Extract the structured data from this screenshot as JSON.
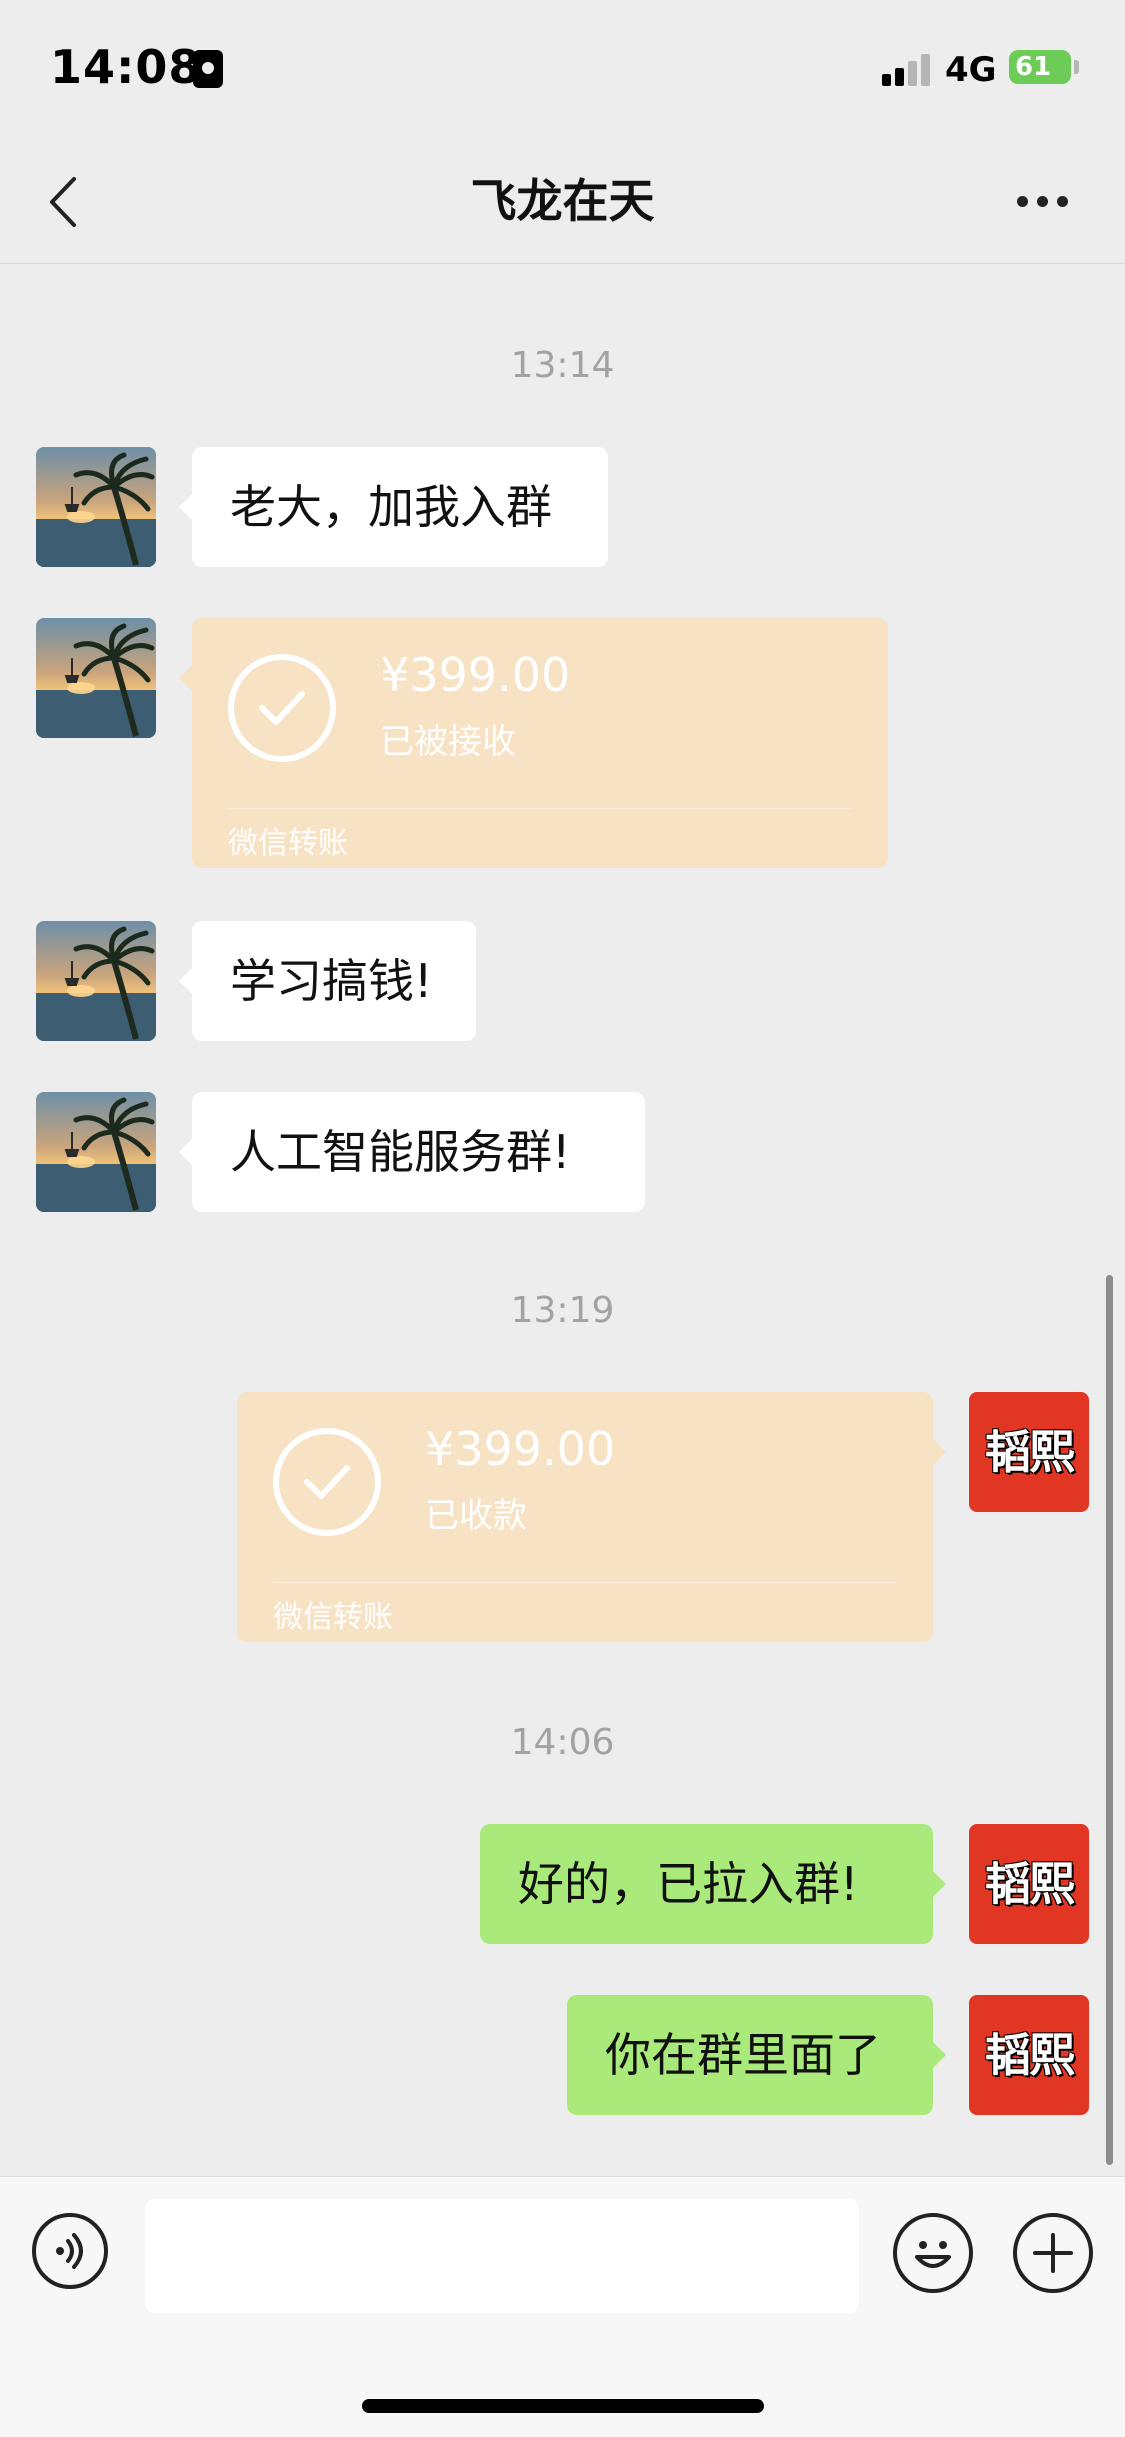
{
  "status_bar": {
    "time": "14:08",
    "network": "4G",
    "battery": "61"
  },
  "header": {
    "title": "飞龙在天"
  },
  "messages": [
    {
      "timestamp": "13:14"
    },
    {
      "text": "老大，加我入群"
    },
    {
      "transfer": {
        "amount": "¥399.00",
        "status": "已被接收",
        "label": "微信转账"
      }
    },
    {
      "text": "学习搞钱!"
    },
    {
      "text": "人工智能服务群!"
    },
    {
      "timestamp": "13:19"
    },
    {
      "transfer": {
        "amount": "¥399.00",
        "status": "已收款",
        "label": "微信转账"
      }
    },
    {
      "timestamp": "14:06"
    },
    {
      "text": "好的，已拉入群!"
    },
    {
      "text": "你在群里面了"
    }
  ],
  "me": {
    "avatar_text": "韬熙",
    "avatar_color": "#e03623"
  },
  "colors": {
    "background": "#ededed",
    "my_bubble": "#a9ea7a",
    "their_bubble": "#ffffff",
    "transfer_card": "#f8e2c4"
  },
  "icons": {
    "back": "chevron-left",
    "more": "ellipsis",
    "voice": "voice-wave",
    "emoji": "smiley",
    "plus": "plus-circle"
  },
  "input": {
    "value": "",
    "placeholder": ""
  }
}
